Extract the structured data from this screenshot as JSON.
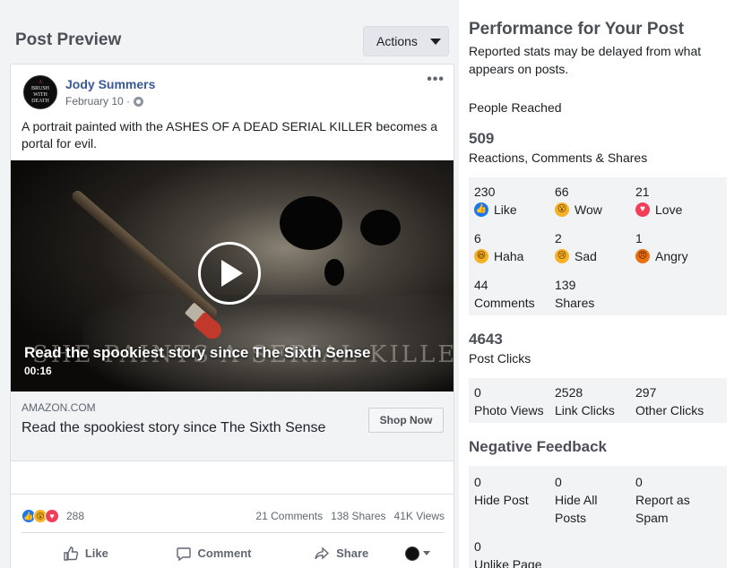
{
  "preview": {
    "title": "Post Preview",
    "actions_label": "Actions",
    "author": "Jody Summers",
    "date": "February 10 ·",
    "avatar_text": [
      "A",
      "BRUSH",
      "WITH",
      "DEATH"
    ],
    "text": "A portrait painted with the ASHES OF A DEAD SERIAL KILLER becomes a portal for evil.",
    "video": {
      "caption": "Read the spookiest story since The Sixth Sense",
      "duration": "00:16",
      "overlay_art_text": "SHE PAINTS A SERIAL KILLER'S PORTRAIT"
    },
    "link": {
      "domain": "AMAZON.COM",
      "title": "Read the spookiest story since The Sixth Sense",
      "cta": "Shop Now"
    },
    "reactions": {
      "count": "288",
      "comments": "21 Comments",
      "shares": "138 Shares",
      "views": "41K Views"
    },
    "actions": {
      "like": "Like",
      "comment": "Comment",
      "share": "Share"
    }
  },
  "performance": {
    "title": "Performance for Your Post",
    "subtitle": "Reported stats may be delayed from what appears on posts.",
    "people_reached_label": "People Reached",
    "people_reached": "509",
    "reactions_label": "Reactions, Comments & Shares",
    "reactions": {
      "like": {
        "value": "230",
        "label": "Like"
      },
      "wow": {
        "value": "66",
        "label": "Wow"
      },
      "love": {
        "value": "21",
        "label": "Love"
      },
      "haha": {
        "value": "6",
        "label": "Haha"
      },
      "sad": {
        "value": "2",
        "label": "Sad"
      },
      "angry": {
        "value": "1",
        "label": "Angry"
      },
      "comments": {
        "value": "44",
        "label": "Comments"
      },
      "shares": {
        "value": "139",
        "label": "Shares"
      }
    },
    "post_clicks": "4643",
    "post_clicks_label": "Post Clicks",
    "clicks": {
      "photo_views": {
        "value": "0",
        "label": "Photo Views"
      },
      "link_clicks": {
        "value": "2528",
        "label": "Link Clicks"
      },
      "other_clicks": {
        "value": "297",
        "label": "Other Clicks"
      }
    },
    "negative_title": "Negative Feedback",
    "negative": {
      "hide_post": {
        "value": "0",
        "label": "Hide Post"
      },
      "hide_all": {
        "value": "0",
        "label": "Hide All Posts"
      },
      "report_spam": {
        "value": "0",
        "label": "Report as Spam"
      },
      "unlike_page": {
        "value": "0",
        "label": "Unlike Page"
      }
    }
  },
  "colors": {
    "link_blue": "#385898",
    "panel_gray": "#f2f3f5",
    "like_blue": "#1877f2",
    "love_red": "#f33e58",
    "wow_yellow": "#f7b125"
  }
}
